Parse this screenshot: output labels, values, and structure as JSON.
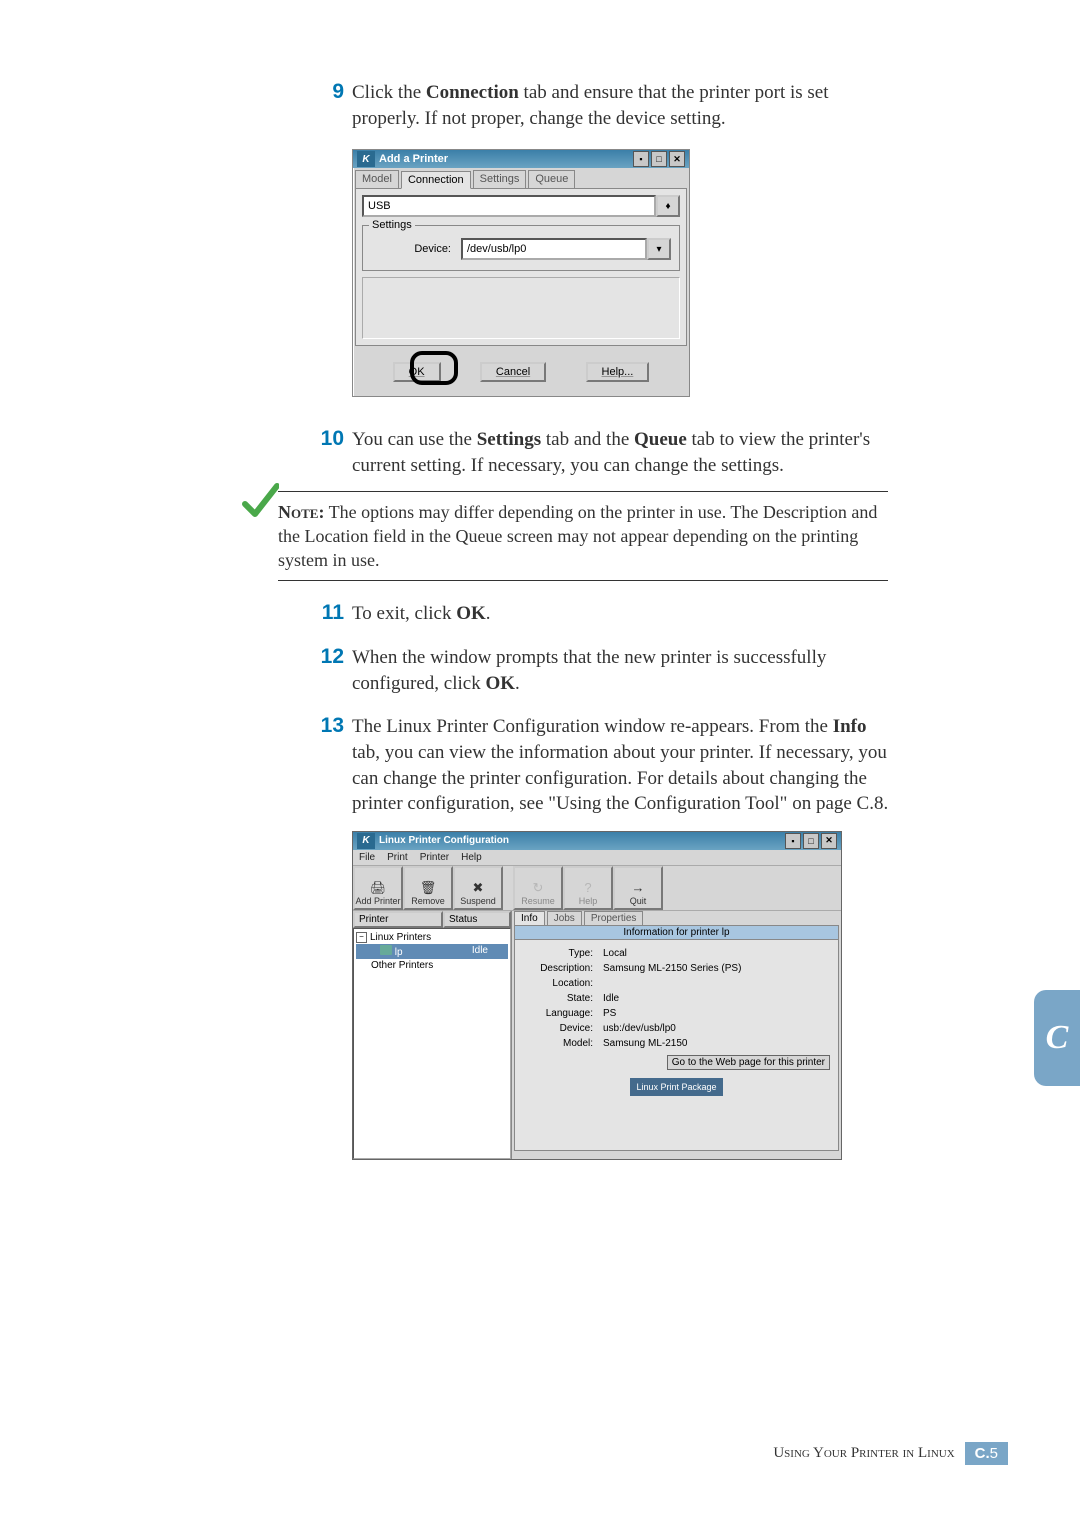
{
  "steps": {
    "s9": {
      "num": "9",
      "text_a": "Click the ",
      "b1": "Connection",
      "text_b": " tab and ensure that the printer port is set properly. If not proper, change the device setting."
    },
    "s10": {
      "num": "10",
      "text_a": "You can use the ",
      "b1": "Settings",
      "text_b": " tab and the ",
      "b2": "Queue",
      "text_c": " tab to view the printer's current setting. If necessary, you can change the settings."
    },
    "s11": {
      "num": "11",
      "text_a": "To exit, click ",
      "b1": "OK",
      "text_b": "."
    },
    "s12": {
      "num": "12",
      "text_a": "When the window prompts that the new printer is successfully configured, click ",
      "b1": "OK",
      "text_b": "."
    },
    "s13": {
      "num": "13",
      "text_a": "The Linux Printer Configuration window re-appears. From the ",
      "b1": "Info",
      "text_b": " tab, you can view the information about your printer. If necessary, you can change the printer configuration. For details about changing the printer configuration, see \"Using the Configuration Tool\" on page C.8."
    }
  },
  "note": {
    "label": "Note:",
    "text": " The options may differ depending on the printer in use. The Description and the Location field in the Queue screen may not appear depending on the printing system in use."
  },
  "dlg1": {
    "title": "Add a Printer",
    "tabs": [
      "Model",
      "Connection",
      "Settings",
      "Queue"
    ],
    "active_tab": 1,
    "combo_value": "USB",
    "settings_legend": "Settings",
    "device_label": "Device:",
    "device_value": "/dev/usb/lp0",
    "buttons": {
      "ok": "OK",
      "cancel": "Cancel",
      "help": "Help..."
    }
  },
  "dlg2": {
    "title": "Linux Printer Configuration",
    "menu": [
      "File",
      "Print",
      "Printer",
      "Help"
    ],
    "toolbar": [
      {
        "label": "Add Printer",
        "icon": "🖨"
      },
      {
        "label": "Remove",
        "icon": "🗑"
      },
      {
        "label": "Suspend",
        "icon": "✖"
      },
      {
        "label": "Resume",
        "icon": "↻",
        "disabled": true
      },
      {
        "label": "Help",
        "icon": "?",
        "disabled": true
      },
      {
        "label": "Quit",
        "icon": "→"
      }
    ],
    "left_headers": [
      "Printer",
      "Status"
    ],
    "tree": {
      "root1": "Linux Printers",
      "sel_name": "lp",
      "sel_status": "Idle",
      "root2": "Other Printers"
    },
    "right_tabs": [
      "Info",
      "Jobs",
      "Properties"
    ],
    "info_title": "Information for printer lp",
    "info": {
      "type_l": "Type:",
      "type_v": "Local",
      "desc_l": "Description:",
      "desc_v": "Samsung ML-2150 Series (PS)",
      "loc_l": "Location:",
      "loc_v": "",
      "state_l": "State:",
      "state_v": "Idle",
      "lang_l": "Language:",
      "lang_v": "PS",
      "dev_l": "Device:",
      "dev_v": "usb:/dev/usb/lp0",
      "model_l": "Model:",
      "model_v": "Samsung ML-2150"
    },
    "weblink": "Go to the Web page for this printer",
    "lpp": "Linux Print Package"
  },
  "pagetab": "C",
  "footer": {
    "text": "Using Your Printer in Linux",
    "box_l": "C.",
    "box_n": "5"
  }
}
